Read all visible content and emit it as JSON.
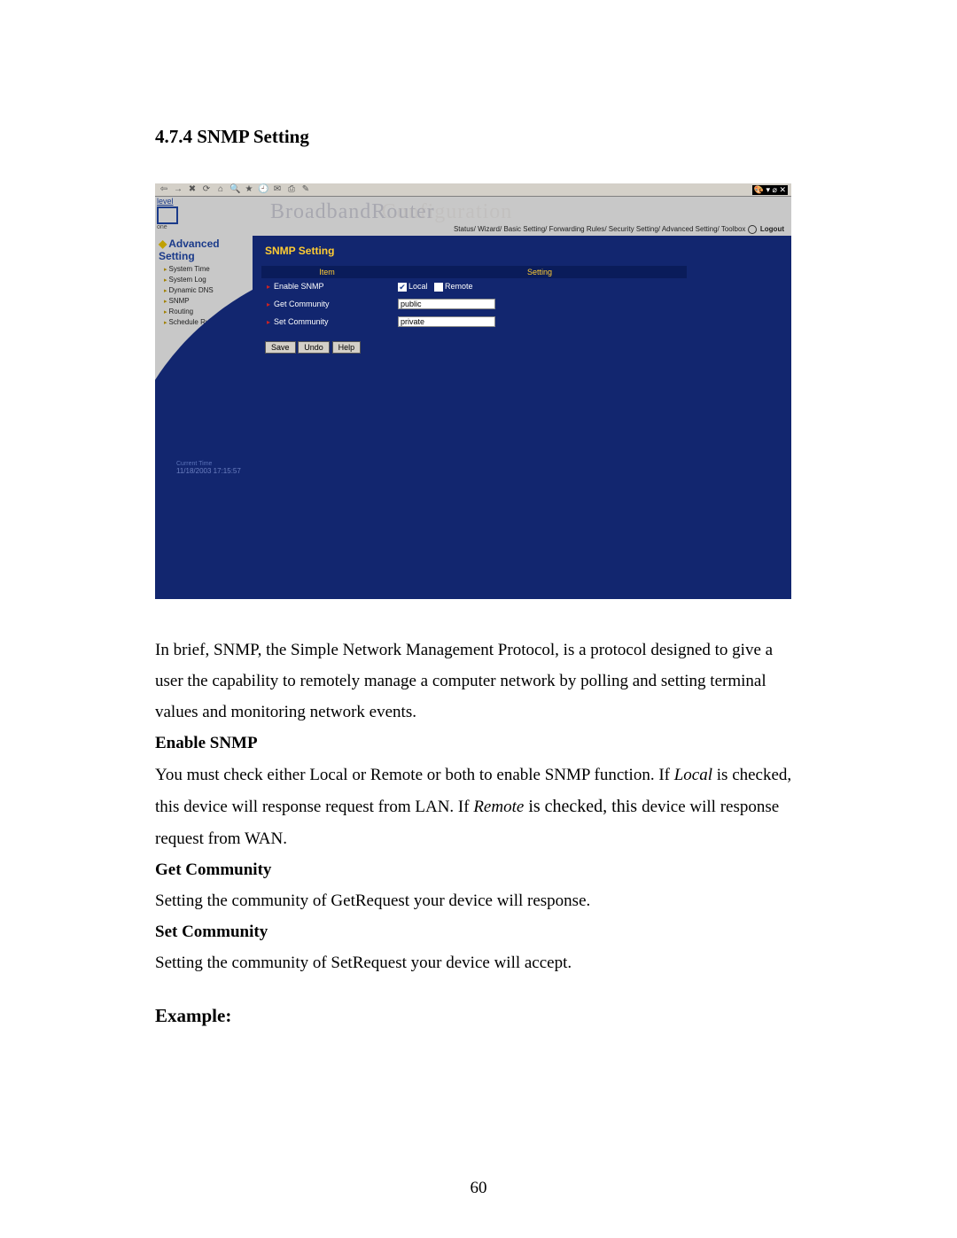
{
  "section": {
    "number": "4.7.4",
    "title": "SNMP Setting"
  },
  "screenshot": {
    "toolbar": {
      "icons": [
        "⇦",
        "→",
        "·",
        "⟳",
        "⌂",
        "⎈",
        "🔍",
        "⌘",
        "▦",
        "✉",
        "✎",
        "⎙",
        "▾",
        "📋"
      ],
      "right": "🎨  ▾ ⌀ ✕"
    },
    "logo": {
      "brand": "level",
      "sub": "one"
    },
    "header_title": "BroadbandRouter",
    "header_ghost": "Configuration",
    "breadcrumb": {
      "items": [
        "Status",
        "Wizard",
        "Basic Setting",
        "Forwarding Rules",
        "Security Setting",
        "Advanced Setting",
        "Toolbox"
      ],
      "logout": "Logout"
    },
    "sidebar": {
      "heading": "Advanced Setting",
      "items": [
        "System Time",
        "System Log",
        "Dynamic DNS",
        "SNMP",
        "Routing",
        "Schedule Rule"
      ],
      "time_label": "Current Time",
      "time_value": "11/18/2003 17:15:57"
    },
    "panel": {
      "heading": "SNMP Setting",
      "col_item": "Item",
      "col_setting": "Setting",
      "rows": {
        "enable_label": "Enable SNMP",
        "local_label": "Local",
        "remote_label": "Remote",
        "local_checked": true,
        "remote_checked": false,
        "get_label": "Get Community",
        "get_value": "public",
        "set_label": "Set Community",
        "set_value": "private"
      },
      "buttons": {
        "save": "Save",
        "undo": "Undo",
        "help": "Help"
      }
    }
  },
  "body": {
    "intro": "In brief, SNMP, the Simple Network Management Protocol, is a protocol designed to give a user the capability to remotely manage a computer network by polling and setting terminal values and monitoring network events.",
    "enable_head": "Enable SNMP",
    "enable_p1a": "You must check either Local or Remote or both to enable SNMP function. If ",
    "enable_local": "Local",
    "enable_p1b": " is checked, this device will response request from LAN. If ",
    "enable_remote": "Remote",
    "enable_p1c": " is checked, this ",
    "enable_p1d": "device will response request from WAN.",
    "get_head": "Get Community",
    "get_text": "Setting the community of GetRequest your device will response.",
    "set_head": "Set Community",
    "set_text": "Setting the community of SetRequest your device will accept.",
    "example_head": "Example:"
  },
  "page_number": "60"
}
